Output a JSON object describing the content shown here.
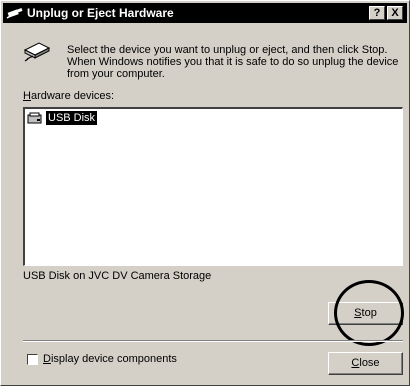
{
  "window": {
    "title": "Unplug or Eject Hardware",
    "help_label": "?",
    "close_label": "X"
  },
  "instructions": "Select the device you want to unplug or eject, and then click Stop. When Windows notifies you that it is safe to do so unplug the device from your computer.",
  "hardware_devices": {
    "label_prefix": "",
    "label_accel": "H",
    "label_rest": "ardware devices:",
    "items": [
      {
        "label": "USB Disk",
        "icon": "usb-disk-icon",
        "selected": true
      }
    ]
  },
  "device_description": "USB Disk on JVC DV Camera Storage",
  "stop_button": {
    "accel": "S",
    "rest": "top"
  },
  "display_components": {
    "accel": "D",
    "rest": "isplay device components",
    "checked": false
  },
  "close_button": {
    "accel": "C",
    "rest": "lose"
  },
  "colors": {
    "titlebar": "#000000",
    "dialog_face": "#d4d0c8",
    "selection": "#000000",
    "annotation_circle": "#000000"
  }
}
